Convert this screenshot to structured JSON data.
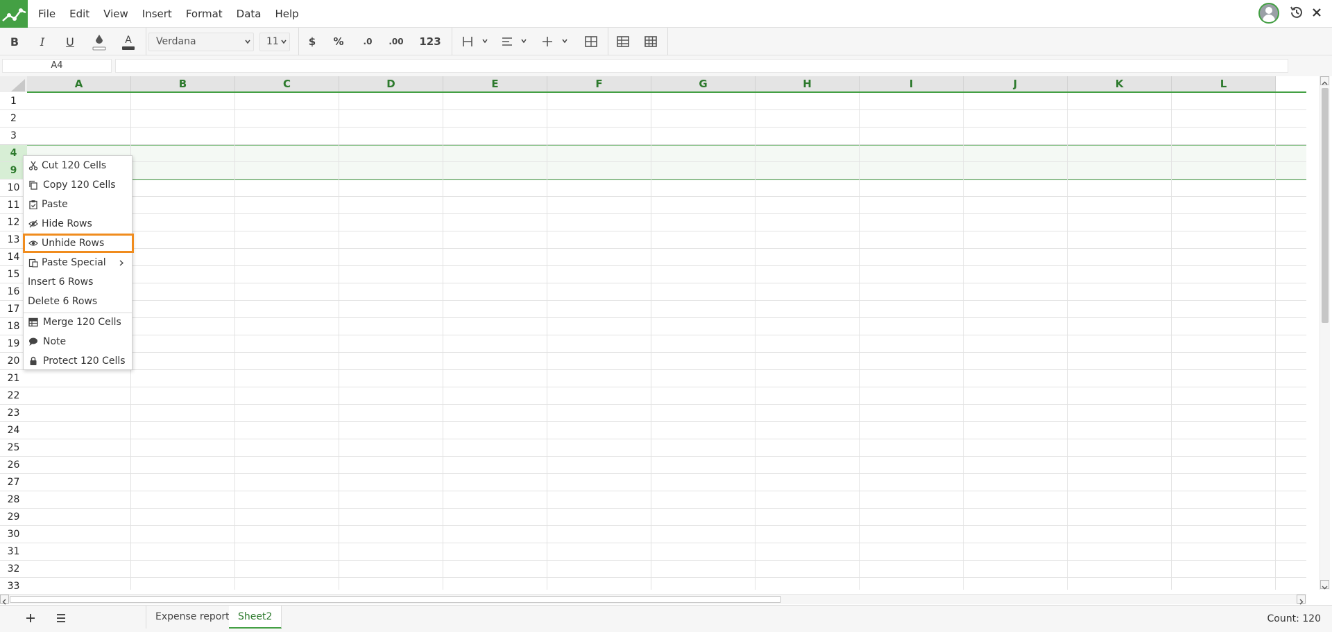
{
  "menubar": {
    "items": [
      "File",
      "Edit",
      "View",
      "Insert",
      "Format",
      "Data",
      "Help"
    ]
  },
  "toolbar": {
    "bold": "B",
    "italic": "I",
    "underline": "U",
    "font": "Verdana",
    "font_size": "11",
    "currency": "$",
    "percent": "%",
    "decimal_decrease": ".0",
    "decimal_increase": ".00",
    "format_number": "123"
  },
  "formula_bar": {
    "cell_ref": "A4",
    "formula": ""
  },
  "grid": {
    "columns": [
      "A",
      "B",
      "C",
      "D",
      "E",
      "F",
      "G",
      "H",
      "I",
      "J",
      "K",
      "L"
    ],
    "rows": [
      "1",
      "2",
      "3",
      "4",
      "9",
      "10",
      "11",
      "12",
      "13",
      "14",
      "15",
      "16",
      "17",
      "18",
      "19",
      "20",
      "21",
      "22",
      "23",
      "24",
      "25",
      "26",
      "27",
      "28",
      "29",
      "30",
      "31",
      "32",
      "33"
    ],
    "selected_rows": [
      "4",
      "9"
    ]
  },
  "context_menu": {
    "items": [
      {
        "label": "Cut 120 Cells",
        "icon": "scissors-icon"
      },
      {
        "label": "Copy 120 Cells",
        "icon": "copy-icon"
      },
      {
        "label": "Paste",
        "icon": "clipboard-icon"
      },
      {
        "label": "Hide Rows",
        "icon": "eye-slash-icon"
      },
      {
        "label": "Unhide Rows",
        "icon": "eye-icon",
        "highlighted": true
      },
      {
        "label": "Paste Special",
        "icon": "paste-special-icon",
        "submenu": true
      },
      {
        "label": "Insert 6 Rows"
      },
      {
        "label": "Delete 6 Rows"
      },
      {
        "label": "Merge 120 Cells",
        "icon": "table-icon"
      },
      {
        "label": "Note",
        "icon": "comment-icon"
      },
      {
        "label": "Protect 120 Cells",
        "icon": "lock-icon"
      }
    ]
  },
  "sheets": {
    "tabs": [
      "Expense report",
      "Sheet2"
    ],
    "active": "Sheet2"
  },
  "status": {
    "count": "Count: 120"
  },
  "colors": {
    "accent": "#44a044",
    "highlight_outline": "#f08c1e"
  }
}
